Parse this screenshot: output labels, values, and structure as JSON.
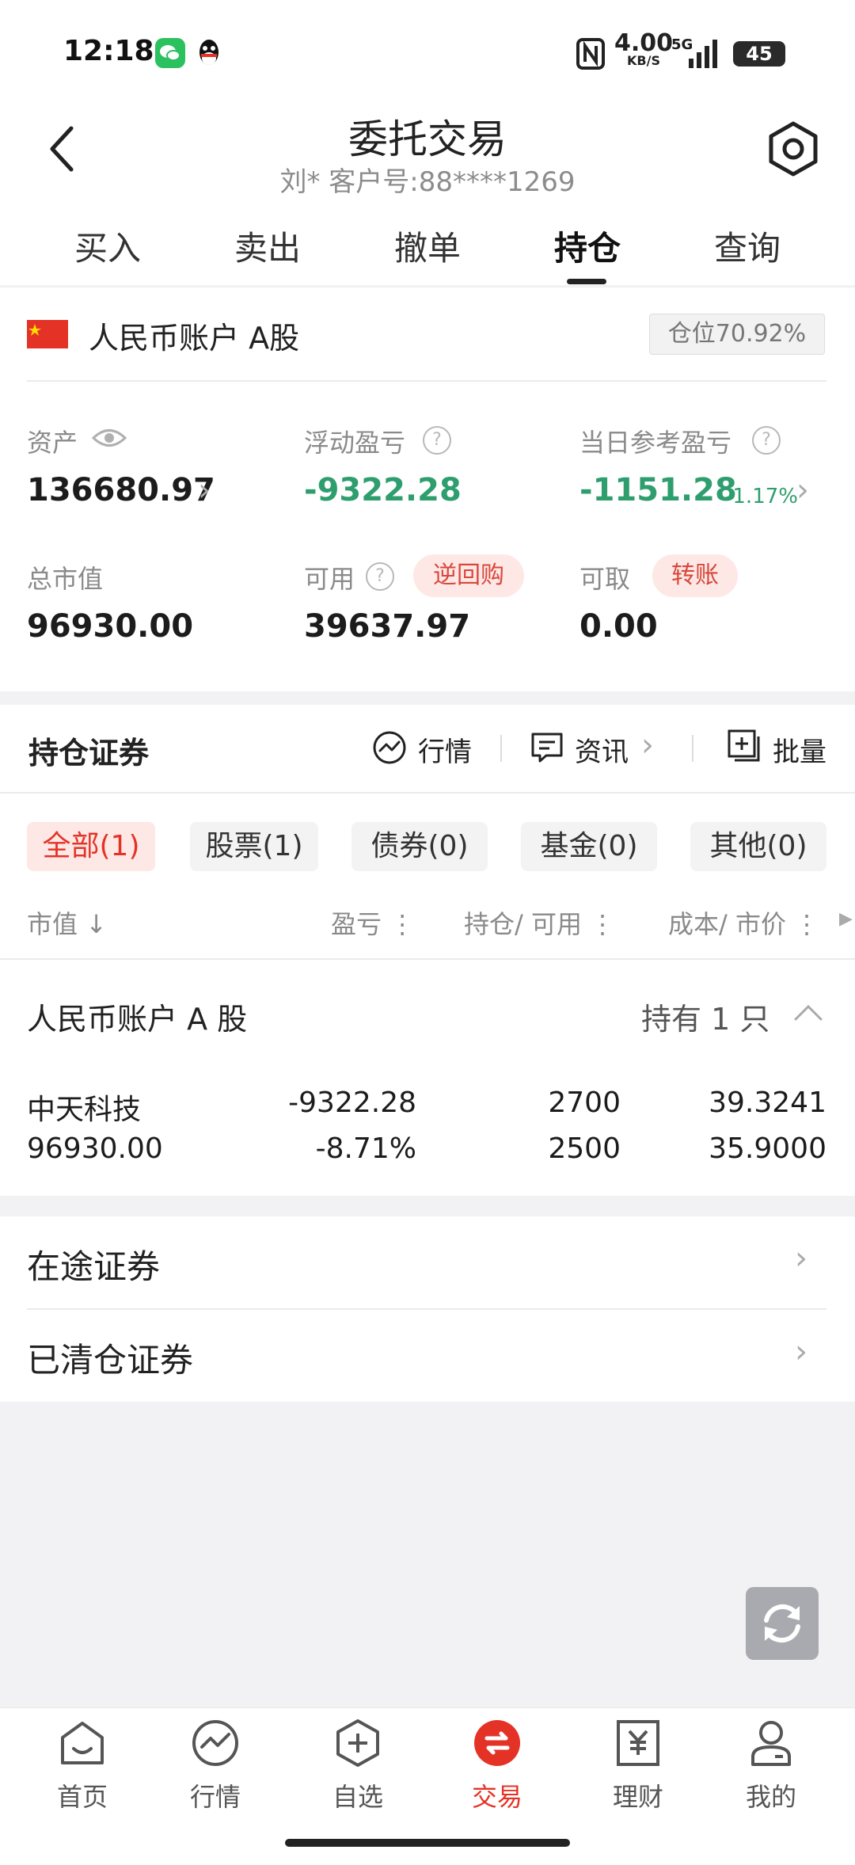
{
  "status_bar": {
    "time": "12:18",
    "net_speed_value": "4.00",
    "net_speed_unit": "KB/S",
    "network": "5G",
    "battery": "45"
  },
  "header": {
    "title": "委托交易",
    "subtitle": "刘* 客户号:88****1269"
  },
  "tabs": [
    {
      "label": "买入"
    },
    {
      "label": "卖出"
    },
    {
      "label": "撤单"
    },
    {
      "label": "持仓",
      "active": true
    },
    {
      "label": "查询"
    }
  ],
  "account": {
    "name": "人民币账户 A股",
    "position_ratio": "仓位70.92%",
    "assets_label": "资产",
    "assets_value": "136680.97",
    "float_pl_label": "浮动盈亏",
    "float_pl_value": "-9322.28",
    "daily_pl_label": "当日参考盈亏",
    "daily_pl_value": "-1151.28",
    "daily_pl_pct": "-1.17%",
    "market_value_label": "总市值",
    "market_value": "96930.00",
    "available_label": "可用",
    "available_value": "39637.97",
    "reverse_repo_label": "逆回购",
    "withdrawable_label": "可取",
    "withdrawable_value": "0.00",
    "transfer_label": "转账"
  },
  "holdings": {
    "title": "持仓证券",
    "tools": {
      "market": "行情",
      "news": "资讯",
      "batch": "批量"
    },
    "filters": [
      {
        "label": "全部(1)",
        "active": true
      },
      {
        "label": "股票(1)"
      },
      {
        "label": "债券(0)"
      },
      {
        "label": "基金(0)"
      },
      {
        "label": "其他(0)"
      }
    ],
    "columns": {
      "market_value": "市值",
      "pl": "盈亏",
      "position": "持仓/ 可用",
      "cost": "成本/ 市价"
    },
    "group": {
      "name": "人民币账户 A 股",
      "count": "持有 1 只"
    },
    "rows": [
      {
        "name": "中天科技",
        "market_value": "96930.00",
        "pl": "-9322.28",
        "pl_pct": "-8.71%",
        "position": "2700",
        "available": "2500",
        "cost": "39.3241",
        "price": "35.9000"
      }
    ]
  },
  "lists": [
    {
      "label": "在途证券"
    },
    {
      "label": "已清仓证券"
    }
  ],
  "nav": [
    {
      "label": "首页",
      "icon": "home-icon"
    },
    {
      "label": "行情",
      "icon": "market-icon"
    },
    {
      "label": "自选",
      "icon": "watchlist-icon"
    },
    {
      "label": "交易",
      "icon": "trade-icon",
      "active": true
    },
    {
      "label": "理财",
      "icon": "finance-icon"
    },
    {
      "label": "我的",
      "icon": "profile-icon"
    }
  ],
  "colors": {
    "accent_red": "#e43326",
    "loss_green": "#2f9e6e"
  }
}
